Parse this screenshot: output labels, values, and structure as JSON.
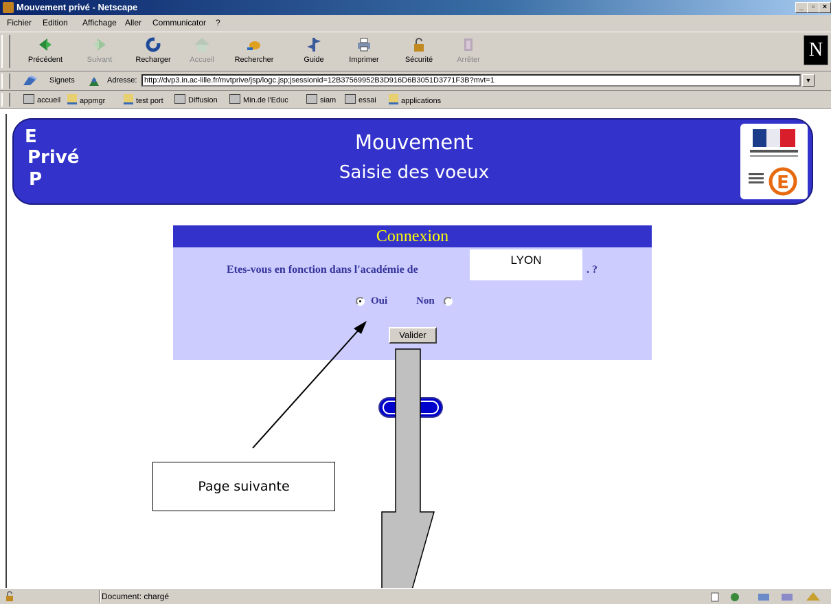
{
  "window": {
    "title": "Mouvement privé - Netscape",
    "buttons": [
      "_",
      "▫",
      "×"
    ]
  },
  "menu": [
    "Fichier",
    "Edition",
    "Affichage",
    "Aller",
    "Communicator",
    "?"
  ],
  "toolbar": {
    "buttons": [
      {
        "label": "Précédent",
        "icon": "back-icon",
        "enabled": true
      },
      {
        "label": "Suivant",
        "icon": "forward-icon",
        "enabled": false
      },
      {
        "label": "Recharger",
        "icon": "reload-icon",
        "enabled": true
      },
      {
        "label": "Accueil",
        "icon": "home-icon",
        "enabled": false
      },
      {
        "label": "Rechercher",
        "icon": "search-icon",
        "enabled": true
      },
      {
        "label": "Guide",
        "icon": "guide-icon",
        "enabled": true
      },
      {
        "label": "Imprimer",
        "icon": "print-icon",
        "enabled": true
      },
      {
        "label": "Sécurité",
        "icon": "lock-icon",
        "enabled": true
      },
      {
        "label": "Arrêter",
        "icon": "stop-icon",
        "enabled": false
      }
    ],
    "logo": "N"
  },
  "location": {
    "bookmarks_label": "Signets",
    "address_label": "Adresse:",
    "url": "http://dvp3.in.ac-lille.fr/mvtprive/jsp/logc.jsp;jsessionid=12B37569952B3D916D6B3051D3771F3B?mvt=1"
  },
  "bookmarks": [
    "accueil",
    "appmgr",
    "test port",
    "Diffusion",
    "Min.de l'Educ",
    "siam",
    "essai",
    "applications"
  ],
  "banner": {
    "logo_lines": [
      "E",
      "Privé",
      "P"
    ],
    "title": "Mouvement",
    "subtitle": "Saisie des voeux"
  },
  "connexion": {
    "header": "Connexion",
    "question": "Etes-vous en fonction dans l'académie de",
    "question_end": ". ?",
    "academy": "LYON",
    "options": [
      {
        "label": "Oui",
        "checked": true
      },
      {
        "label": "Non",
        "checked": false
      }
    ],
    "submit": "Valider"
  },
  "annotation": {
    "callout": "Page suivante"
  },
  "status": {
    "text": "Document: chargé"
  },
  "colors": {
    "banner": "#3333cc",
    "panel": "#ccccff",
    "header_text": "#ffff00",
    "label": "#333399",
    "titlebar": "#0a246a",
    "chrome": "#d4d0c8"
  }
}
